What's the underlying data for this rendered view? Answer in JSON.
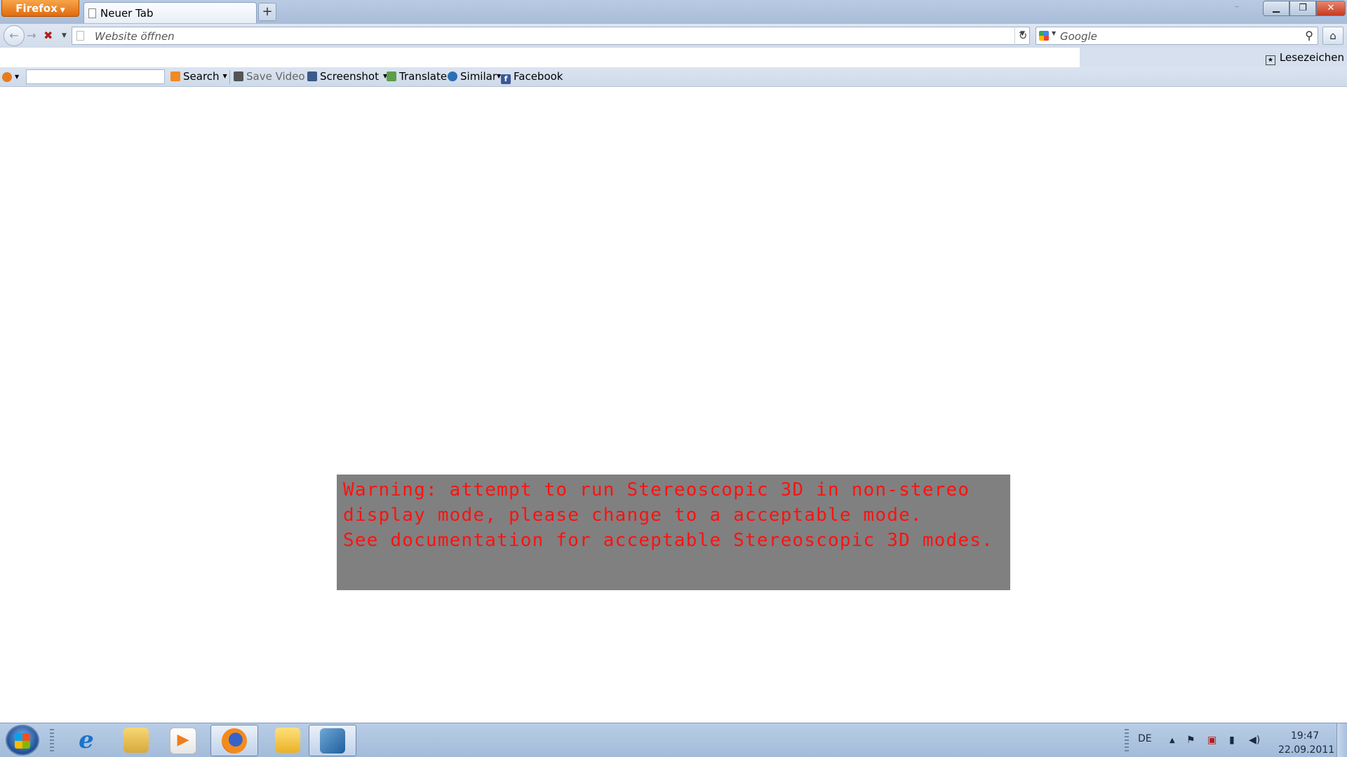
{
  "browser": {
    "app_button": "Firefox",
    "tab_title": "Neuer Tab",
    "new_tab_symbol": "+",
    "url_placeholder": "Website öffnen",
    "search_engine_placeholder": "Google",
    "bookmarks_label": "Lesezeichen"
  },
  "addon_toolbar": {
    "search_label": "Search",
    "save_video_label": "Save Video",
    "screenshot_label": "Screenshot",
    "translate_label": "Translate",
    "similar_label": "Similar",
    "facebook_label": "Facebook"
  },
  "warning": {
    "lines": [
      "Warning: attempt to run Stereoscopic 3D in non-stereo",
      "display mode, please change to a acceptable mode.",
      "See documentation for acceptable Stereoscopic 3D modes."
    ],
    "text_color": "#ff1111",
    "background": "#808080"
  },
  "taskbar": {
    "language": "DE",
    "time": "19:47",
    "date": "22.09.2011",
    "apps": [
      "internet-explorer-icon",
      "windows-explorer-icon",
      "media-player-icon",
      "firefox-icon",
      "outlook-icon",
      "program-icon"
    ]
  },
  "colors": {
    "firefox_button": "#e16b0d",
    "close_button": "#c43b20"
  }
}
